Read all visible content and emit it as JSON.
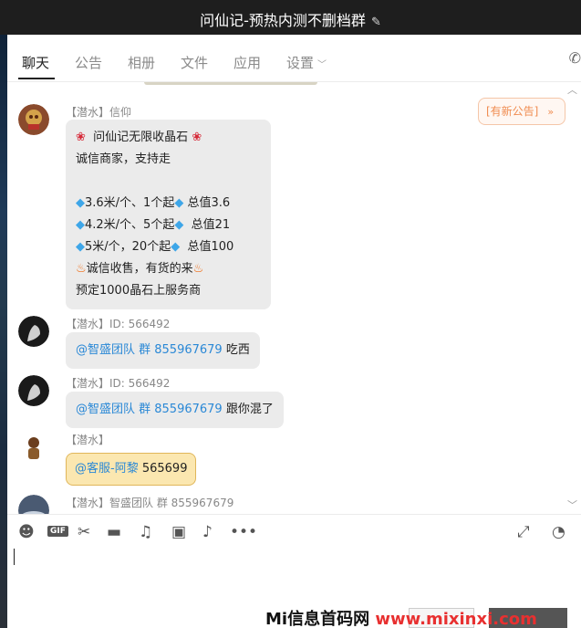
{
  "window": {
    "title": "问仙记-预热内测不删档群",
    "edit_icon": "pencil-icon"
  },
  "tabs": [
    {
      "label": "聊天",
      "active": true
    },
    {
      "label": "公告"
    },
    {
      "label": "相册"
    },
    {
      "label": "文件"
    },
    {
      "label": "应用"
    },
    {
      "label": "设置"
    }
  ],
  "notice": {
    "label": "[有新公告]",
    "arrow": "»"
  },
  "messages": [
    {
      "sender": "【潜水】信仰",
      "lines": [
        "问仙记无限收晶石",
        "诚信商家，支持走",
        "",
        "3.6米/个、1个起",
        "4.2米/个、5个起",
        "5米/个，20个起",
        "诚信收售，有货的来",
        "预定1000晶石上服务商"
      ],
      "totals": [
        "总值3.6",
        "总值21",
        "总值100"
      ]
    },
    {
      "sender": "【潜水】ID: 566492",
      "mention": "@智盛团队 群 855967679",
      "text": "吃西"
    },
    {
      "sender": "【潜水】ID: 566492",
      "mention": "@智盛团队 群 855967679",
      "text": "跟你混了"
    },
    {
      "sender": "【潜水】",
      "mention": "@客服-阿黎",
      "text": "565699"
    },
    {
      "sender": "【潜水】智盛团队 群 855967679"
    }
  ],
  "toolbar": {
    "icons": [
      "emoji-icon",
      "gif-icon",
      "scissors-icon",
      "folder-icon",
      "music-icon",
      "image-icon",
      "bell-icon",
      "more-icon",
      "expand-icon",
      "clock-icon"
    ],
    "gif_label": "GIF"
  },
  "watermark": {
    "brand": "Mi信息首码网",
    "url": "www.mixinxi.com"
  },
  "colors": {
    "titlebar": "#1e1e1e",
    "mention": "#2a88d6",
    "notice": "#f08c50",
    "bubble": "#ebebeb"
  }
}
